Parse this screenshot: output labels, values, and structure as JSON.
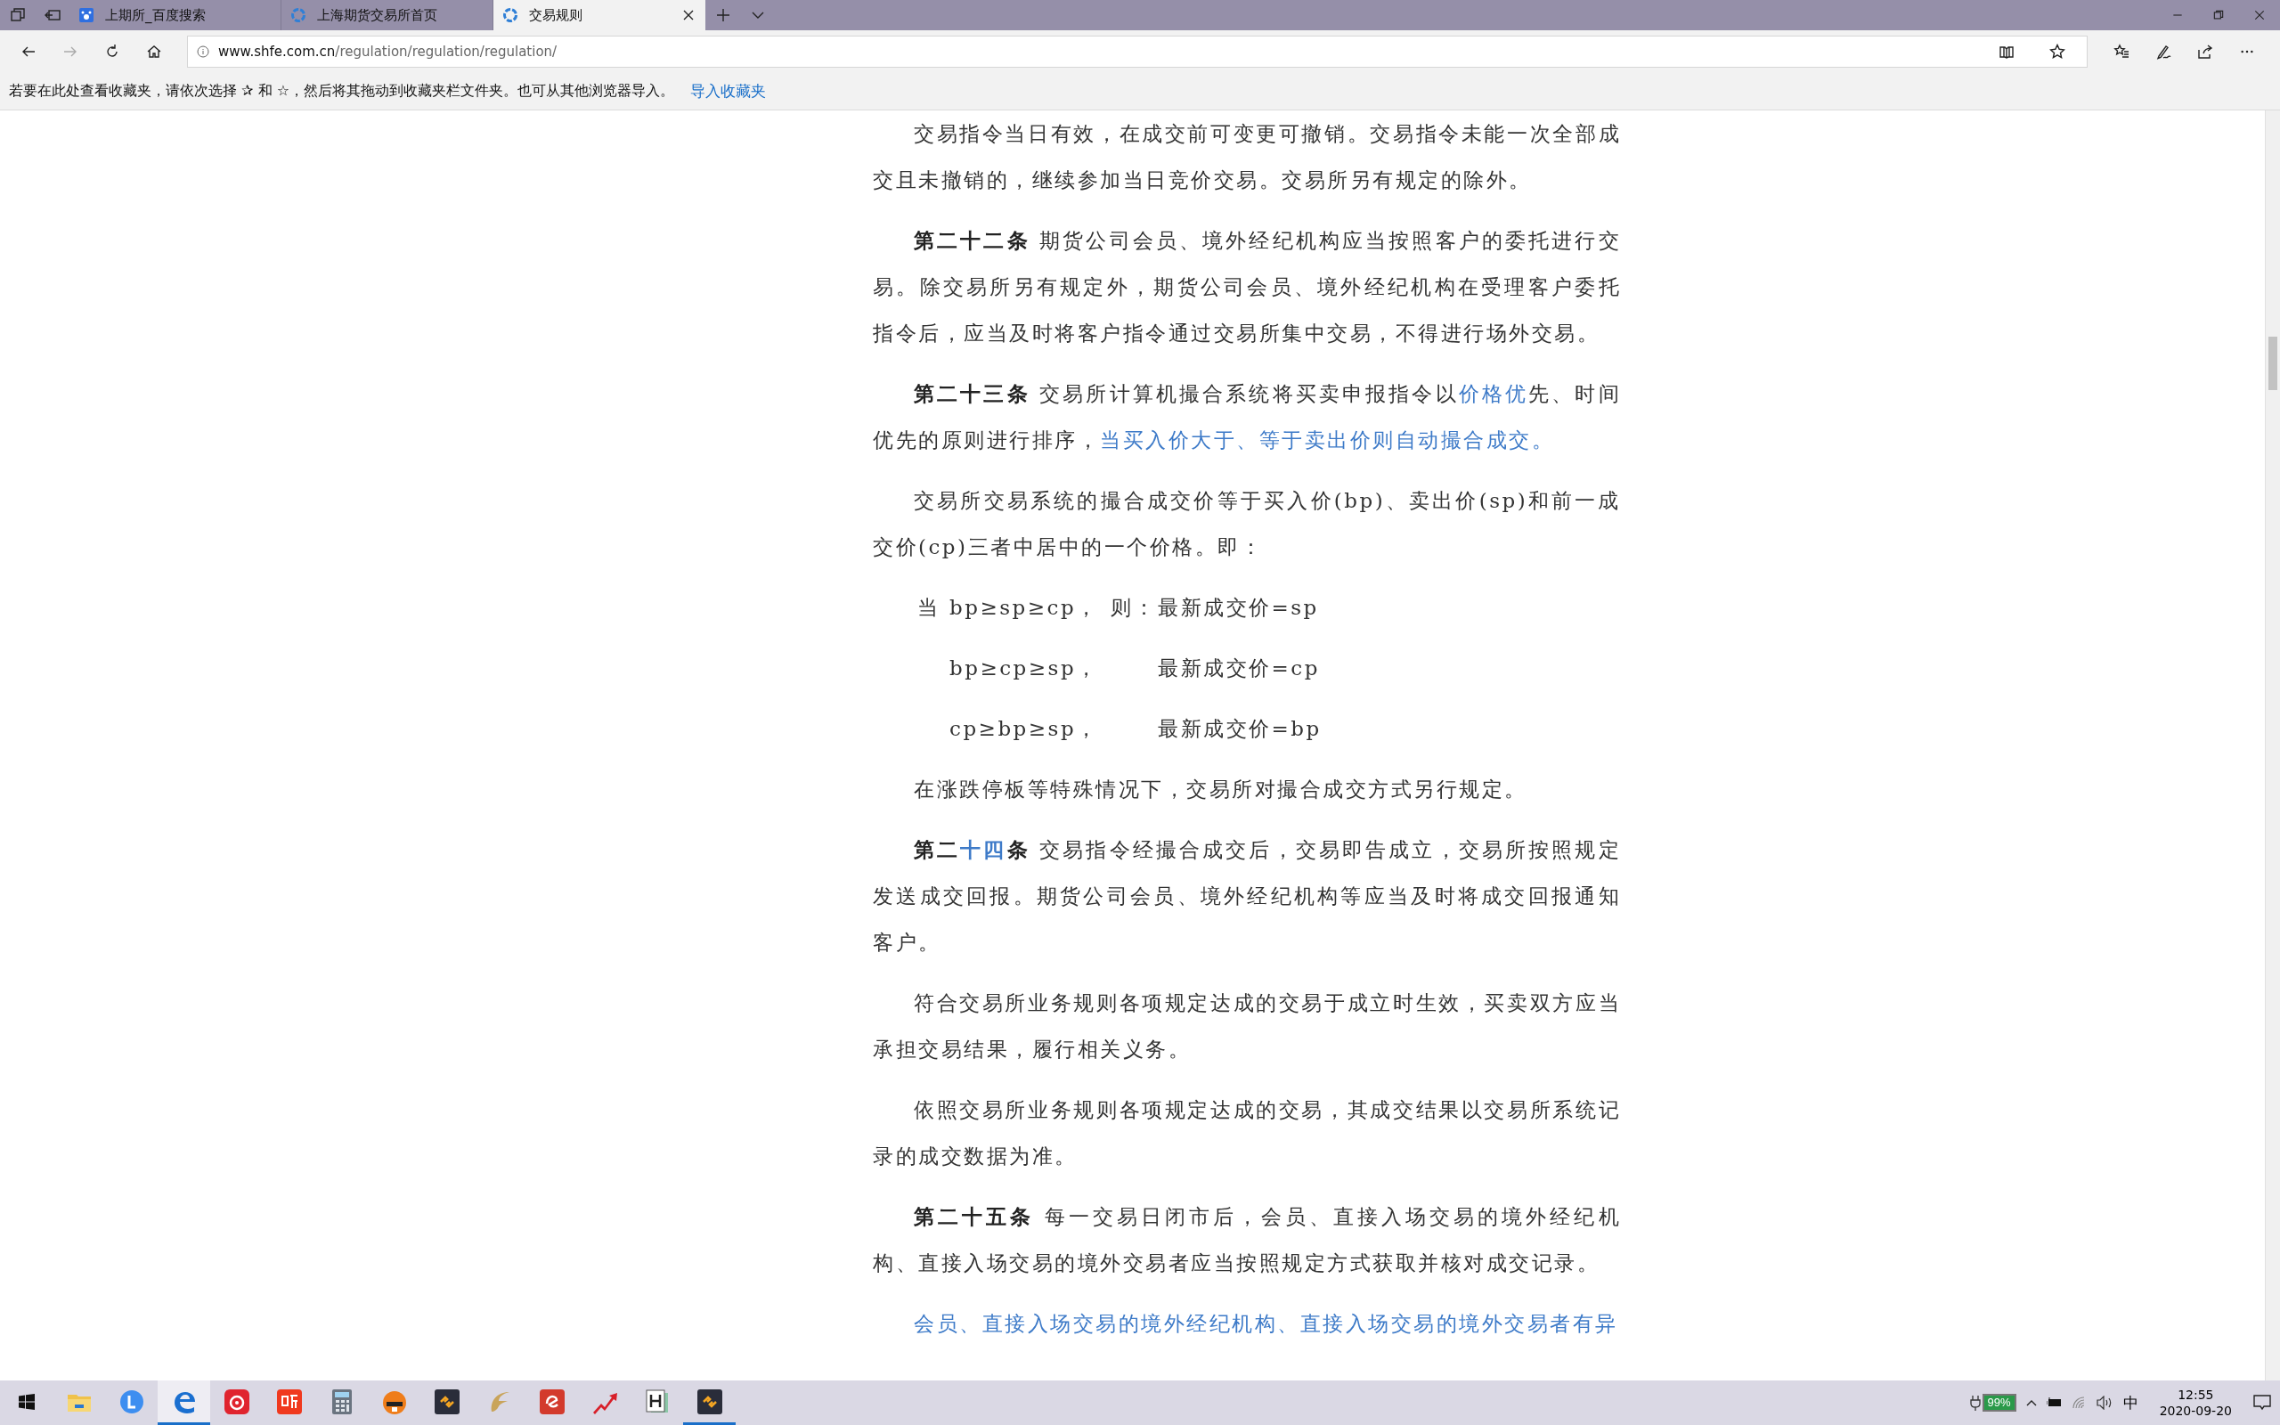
{
  "tabs": [
    {
      "title": "上期所_百度搜索",
      "selected": false
    },
    {
      "title": "上海期货交易所首页",
      "selected": false
    },
    {
      "title": "交易规则",
      "selected": true
    }
  ],
  "address_bar": {
    "host": "www.shfe.com.cn",
    "path": "/regulation/regulation/regulation/"
  },
  "favorites_bar": {
    "message": "若要在此处查看收藏夹，请依次选择 ✰ 和 ☆，然后将其拖动到收藏夹栏文件夹。也可从其他浏览器导入。",
    "link": "导入收藏夹"
  },
  "article": [
    {
      "kind": "paragraph",
      "segments": [
        {
          "text": "交易指令当日有效，在成交前可变更可撤销。交易指令未能一次全部成交且未撤销的，继续参加当日竞价交易。交易所另有规定的除外。",
          "bold": false,
          "marked": false
        }
      ]
    },
    {
      "kind": "paragraph",
      "segments": [
        {
          "text": "第二十二条",
          "bold": true,
          "marked": false
        },
        {
          "text": " 期货公司会员、境外经纪机构应当按照客户的委托进行交易。除交易所另有规定外，期货公司会员、境外经纪机构在受理客户委托指令后，应当及时将客户指令通过交易所集中交易，不得进行场外交易。",
          "bold": false,
          "marked": false
        }
      ]
    },
    {
      "kind": "paragraph",
      "segments": [
        {
          "text": "第二十三条",
          "bold": true,
          "marked": false
        },
        {
          "text": " 交易所计算机撮合系统将买卖申报指令以",
          "bold": false,
          "marked": false
        },
        {
          "text": "价格优",
          "bold": false,
          "marked": true
        },
        {
          "text": "先、时间优先的原则进行排序，",
          "bold": false,
          "marked": false
        },
        {
          "text": "当买入价大于、等于卖出价则自动撮合成交。",
          "bold": false,
          "marked": true
        }
      ]
    },
    {
      "kind": "paragraph",
      "segments": [
        {
          "text": "交易所交易系统的撮合成交价等于买入价(bp)、卖出价(sp)和前一成交价(cp)三者中居中的一个价格。即：",
          "bold": false,
          "marked": false
        }
      ]
    },
    {
      "kind": "formula",
      "prefix": "当",
      "condition": "bp≥sp≥cp，",
      "then": "则：",
      "result": "最新成交价=sp"
    },
    {
      "kind": "formula",
      "condition": "bp≥cp≥sp，",
      "result": "最新成交价=cp"
    },
    {
      "kind": "formula",
      "condition": "cp≥bp≥sp，",
      "result": "最新成交价=bp"
    },
    {
      "kind": "paragraph",
      "segments": [
        {
          "text": "在涨跌停板等特殊情况下，交易所对撮合成交方式另行规定。",
          "bold": false,
          "marked": false
        }
      ]
    },
    {
      "kind": "paragraph",
      "segments": [
        {
          "text": "第二",
          "bold": true,
          "marked": false
        },
        {
          "text": "十四",
          "bold": true,
          "marked": true
        },
        {
          "text": "条",
          "bold": true,
          "marked": false
        },
        {
          "text": " 交易指令经撮合成交后，交易即告成立，交易所按照规定发送成交回报。期货公司会员、境外经纪机构等应当及时将成交回报通知客户。",
          "bold": false,
          "marked": false
        }
      ]
    },
    {
      "kind": "paragraph",
      "segments": [
        {
          "text": "符合交易所业务规则各项规定达成的交易于成立时生效，买卖双方应当承担交易结果，履行相关义务。",
          "bold": false,
          "marked": false
        }
      ]
    },
    {
      "kind": "paragraph",
      "segments": [
        {
          "text": "依照交易所业务规则各项规定达成的交易，其成交结果以交易所系统记录的成交数据为准。",
          "bold": false,
          "marked": false
        }
      ]
    },
    {
      "kind": "paragraph",
      "segments": [
        {
          "text": "第二十五条",
          "bold": true,
          "marked": false
        },
        {
          "text": " 每一交易日闭市后，会员、直接入场交易的境外经纪机构、直接入场交易的境外交易者应当按照规定方式获取并核对成交记录。",
          "bold": false,
          "marked": false
        }
      ]
    },
    {
      "kind": "paragraph",
      "segments": [
        {
          "text": "会员、直接入场交易的境外经纪机构、直接入场交易的境外交易者有异",
          "bold": false,
          "marked": true
        }
      ]
    }
  ],
  "taskbar": {
    "apps": [
      {
        "kind": "folder",
        "selected": false,
        "running": false
      },
      {
        "kind": "l-circle",
        "selected": false,
        "running": false
      },
      {
        "kind": "edge",
        "selected": true,
        "running": true
      },
      {
        "kind": "music",
        "selected": false,
        "running": false
      },
      {
        "kind": "listen",
        "selected": false,
        "running": false
      },
      {
        "kind": "calculator",
        "selected": false,
        "running": false
      },
      {
        "kind": "cat",
        "selected": false,
        "running": false
      },
      {
        "kind": "dark-link",
        "selected": false,
        "running": false
      },
      {
        "kind": "gold-f",
        "selected": false,
        "running": false
      },
      {
        "kind": "red-square",
        "selected": false,
        "running": false
      },
      {
        "kind": "arrow",
        "selected": false,
        "running": false
      },
      {
        "kind": "h-doc",
        "selected": false,
        "running": false
      },
      {
        "kind": "dark-link",
        "selected": false,
        "running": true
      }
    ],
    "battery": "99%",
    "ime": "中",
    "time": "12:55",
    "date": "2020-09-20"
  }
}
